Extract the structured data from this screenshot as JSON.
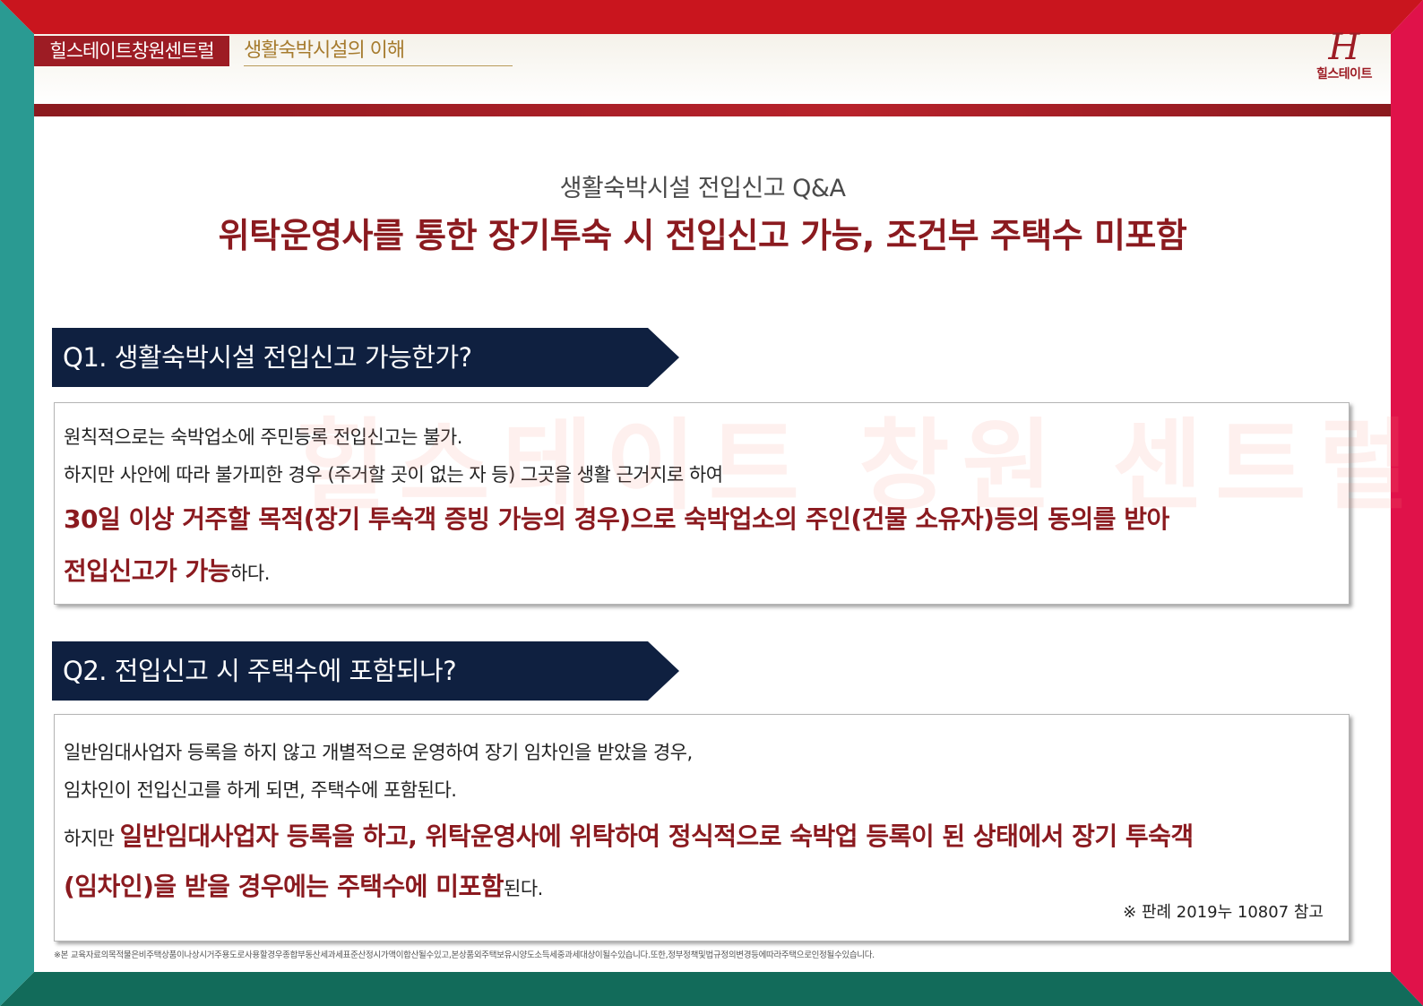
{
  "header": {
    "brand_tab": "힐스테이트창원센트럴",
    "section_title": "생활숙박시설의 이해",
    "logo_mark": "H",
    "logo_text": "힐스테이트"
  },
  "main": {
    "subtitle": "생활숙박시설 전입신고 Q&A",
    "title": "위탁운영사를 통한 장기투숙 시 전입신고 가능, 조건부 주택수 미포함"
  },
  "watermark": "힐스테이트 창원 센트럴",
  "q1": {
    "question": "Q1. 생활숙박시설 전입신고 가능한가?",
    "line1": "원칙적으로는 숙박업소에 주민등록 전입신고는 불가.",
    "line2": "하지만 사안에 따라 불가피한 경우 (주거할 곳이 없는 자 등) 그곳을 생활 근거지로 하여",
    "line3_em": "30일 이상 거주할 목적(장기 투숙객 증빙 가능의 경우)으로 숙박업소의 주인(건물 소유자)등의 동의를 받아",
    "line4_em": "전입신고가 가능",
    "line4_tail": "하다."
  },
  "q2": {
    "question": "Q2. 전입신고 시 주택수에 포함되나?",
    "line1": "일반임대사업자 등록을 하지 않고 개별적으로 운영하여 장기 임차인을 받았을 경우,",
    "line2": "임차인이 전입신고를 하게 되면, 주택수에 포함된다.",
    "line3_pre": "하지만 ",
    "line3_em": "일반임대사업자 등록을 하고, 위탁운영사에 위탁하여 정식적으로 숙박업 등록이 된 상태에서 장기 투숙객",
    "line4_em": "(임차인)을 받을 경우에는 주택수에 미포함",
    "line4_tail": "된다.",
    "reference": "※ 판례 2019누 10807 참고"
  },
  "footnote": "※본 교육자료의목적물은비주택상품이나상시거주용도로사용할경우종합부동산세과세표준산정시가액이합산될수있고,본상품외주택보유시양도소득세중과세대상이될수있습니다.또한,정부정책및법규정의변경등에따라주택으로인정될수있습니다.",
  "colors": {
    "brand_red": "#9d1c24",
    "title_red": "#8b1a1f",
    "navy": "#0f2040",
    "teal": "#2a9a92",
    "gold": "#a67b2e"
  }
}
